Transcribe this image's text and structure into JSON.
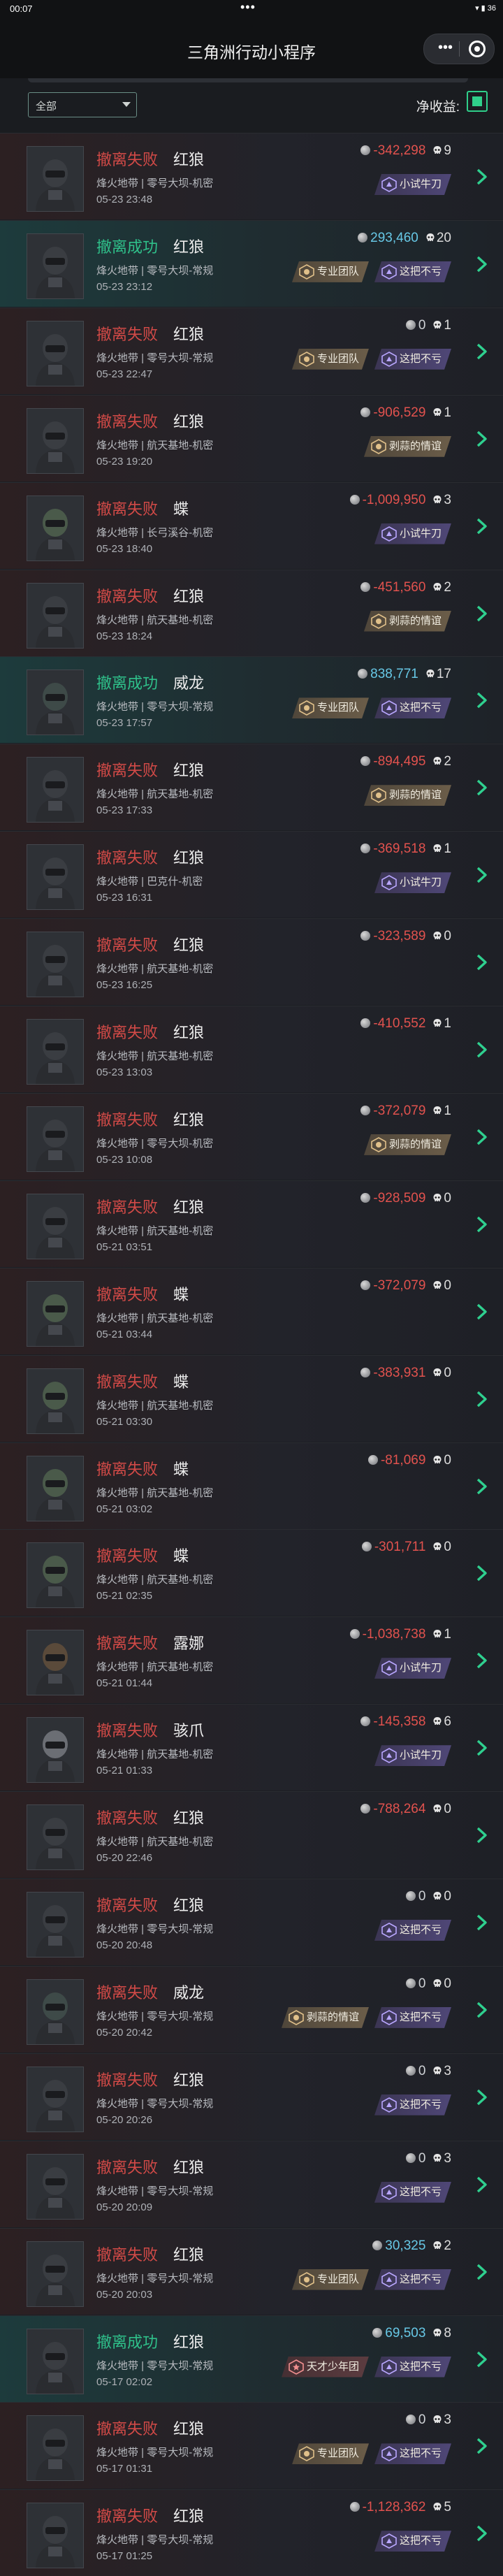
{
  "statusbar": {
    "time": "00:07",
    "dots": "•••",
    "sys": "▾ ▮ 36"
  },
  "app": {
    "title": "三角洲行动小程序"
  },
  "filter": {
    "selected": "全部"
  },
  "income_label": "净收益:",
  "colors": {
    "fail": "#d24a47",
    "success": "#2fc08a",
    "negative": "#e2524e",
    "positive": "#67c8e6",
    "toggle": "#2fcf8a"
  },
  "records": [
    {
      "result": "撤离失败",
      "operator": "红狼",
      "map": "烽火地带 | 零号大坝-机密",
      "date": "05-23 23:48",
      "amount": "-342,298",
      "kills": "9",
      "badges": [
        {
          "label": "小试牛刀",
          "style": "purple"
        }
      ]
    },
    {
      "result": "撤离成功",
      "operator": "红狼",
      "map": "烽火地带 | 零号大坝-常规",
      "date": "05-23 23:12",
      "amount": "293,460",
      "kills": "20",
      "badges": [
        {
          "label": "专业团队",
          "style": "gold"
        },
        {
          "label": "这把不亏",
          "style": "purple"
        }
      ]
    },
    {
      "result": "撤离失败",
      "operator": "红狼",
      "map": "烽火地带 | 零号大坝-常规",
      "date": "05-23 22:47",
      "amount": "0",
      "kills": "1",
      "badges": [
        {
          "label": "专业团队",
          "style": "gold"
        },
        {
          "label": "这把不亏",
          "style": "purple"
        }
      ]
    },
    {
      "result": "撤离失败",
      "operator": "红狼",
      "map": "烽火地带 | 航天基地-机密",
      "date": "05-23 19:20",
      "amount": "-906,529",
      "kills": "1",
      "badges": [
        {
          "label": "剥蒜的情谊",
          "style": "gold"
        }
      ]
    },
    {
      "result": "撤离失败",
      "operator": "蝶",
      "map": "烽火地带 | 长弓溪谷-机密",
      "date": "05-23 18:40",
      "amount": "-1,009,950",
      "kills": "3",
      "badges": [
        {
          "label": "小试牛刀",
          "style": "purple"
        }
      ]
    },
    {
      "result": "撤离失败",
      "operator": "红狼",
      "map": "烽火地带 | 航天基地-机密",
      "date": "05-23 18:24",
      "amount": "-451,560",
      "kills": "2",
      "badges": [
        {
          "label": "剥蒜的情谊",
          "style": "gold"
        }
      ]
    },
    {
      "result": "撤离成功",
      "operator": "威龙",
      "map": "烽火地带 | 零号大坝-常规",
      "date": "05-23 17:57",
      "amount": "838,771",
      "kills": "17",
      "badges": [
        {
          "label": "专业团队",
          "style": "gold"
        },
        {
          "label": "这把不亏",
          "style": "purple"
        }
      ]
    },
    {
      "result": "撤离失败",
      "operator": "红狼",
      "map": "烽火地带 | 航天基地-机密",
      "date": "05-23 17:33",
      "amount": "-894,495",
      "kills": "2",
      "badges": [
        {
          "label": "剥蒜的情谊",
          "style": "gold"
        }
      ]
    },
    {
      "result": "撤离失败",
      "operator": "红狼",
      "map": "烽火地带 | 巴克什-机密",
      "date": "05-23 16:31",
      "amount": "-369,518",
      "kills": "1",
      "badges": [
        {
          "label": "小试牛刀",
          "style": "purple"
        }
      ]
    },
    {
      "result": "撤离失败",
      "operator": "红狼",
      "map": "烽火地带 | 航天基地-机密",
      "date": "05-23 16:25",
      "amount": "-323,589",
      "kills": "0",
      "badges": []
    },
    {
      "result": "撤离失败",
      "operator": "红狼",
      "map": "烽火地带 | 航天基地-机密",
      "date": "05-23 13:03",
      "amount": "-410,552",
      "kills": "1",
      "badges": []
    },
    {
      "result": "撤离失败",
      "operator": "红狼",
      "map": "烽火地带 | 零号大坝-机密",
      "date": "05-23 10:08",
      "amount": "-372,079",
      "kills": "1",
      "badges": [
        {
          "label": "剥蒜的情谊",
          "style": "gold"
        }
      ]
    },
    {
      "result": "撤离失败",
      "operator": "红狼",
      "map": "烽火地带 | 航天基地-机密",
      "date": "05-21 03:51",
      "amount": "-928,509",
      "kills": "0",
      "badges": []
    },
    {
      "result": "撤离失败",
      "operator": "蝶",
      "map": "烽火地带 | 航天基地-机密",
      "date": "05-21 03:44",
      "amount": "-372,079",
      "kills": "0",
      "badges": []
    },
    {
      "result": "撤离失败",
      "operator": "蝶",
      "map": "烽火地带 | 航天基地-机密",
      "date": "05-21 03:30",
      "amount": "-383,931",
      "kills": "0",
      "badges": []
    },
    {
      "result": "撤离失败",
      "operator": "蝶",
      "map": "烽火地带 | 航天基地-机密",
      "date": "05-21 03:02",
      "amount": "-81,069",
      "kills": "0",
      "badges": []
    },
    {
      "result": "撤离失败",
      "operator": "蝶",
      "map": "烽火地带 | 航天基地-机密",
      "date": "05-21 02:35",
      "amount": "-301,711",
      "kills": "0",
      "badges": []
    },
    {
      "result": "撤离失败",
      "operator": "露娜",
      "map": "烽火地带 | 航天基地-机密",
      "date": "05-21 01:44",
      "amount": "-1,038,738",
      "kills": "1",
      "badges": [
        {
          "label": "小试牛刀",
          "style": "purple"
        }
      ]
    },
    {
      "result": "撤离失败",
      "operator": "骇爪",
      "map": "烽火地带 | 航天基地-机密",
      "date": "05-21 01:33",
      "amount": "-145,358",
      "kills": "6",
      "badges": [
        {
          "label": "小试牛刀",
          "style": "purple"
        }
      ]
    },
    {
      "result": "撤离失败",
      "operator": "红狼",
      "map": "烽火地带 | 航天基地-机密",
      "date": "05-20 22:46",
      "amount": "-788,264",
      "kills": "0",
      "badges": []
    },
    {
      "result": "撤离失败",
      "operator": "红狼",
      "map": "烽火地带 | 零号大坝-常规",
      "date": "05-20 20:48",
      "amount": "0",
      "kills": "0",
      "badges": [
        {
          "label": "这把不亏",
          "style": "purple"
        }
      ]
    },
    {
      "result": "撤离失败",
      "operator": "威龙",
      "map": "烽火地带 | 零号大坝-常规",
      "date": "05-20 20:42",
      "amount": "0",
      "kills": "0",
      "badges": [
        {
          "label": "剥蒜的情谊",
          "style": "gold"
        },
        {
          "label": "这把不亏",
          "style": "purple"
        }
      ]
    },
    {
      "result": "撤离失败",
      "operator": "红狼",
      "map": "烽火地带 | 零号大坝-常规",
      "date": "05-20 20:26",
      "amount": "0",
      "kills": "3",
      "badges": [
        {
          "label": "这把不亏",
          "style": "purple"
        }
      ]
    },
    {
      "result": "撤离失败",
      "operator": "红狼",
      "map": "烽火地带 | 零号大坝-常规",
      "date": "05-20 20:09",
      "amount": "0",
      "kills": "3",
      "badges": [
        {
          "label": "这把不亏",
          "style": "purple"
        }
      ]
    },
    {
      "result": "撤离失败",
      "operator": "红狼",
      "map": "烽火地带 | 零号大坝-常规",
      "date": "05-20 20:03",
      "amount": "30,325",
      "kills": "2",
      "badges": [
        {
          "label": "专业团队",
          "style": "gold"
        },
        {
          "label": "这把不亏",
          "style": "purple"
        }
      ]
    },
    {
      "result": "撤离成功",
      "operator": "红狼",
      "map": "烽火地带 | 零号大坝-常规",
      "date": "05-17 02:02",
      "amount": "69,503",
      "kills": "8",
      "badges": [
        {
          "label": "天才少年团",
          "style": "red"
        },
        {
          "label": "这把不亏",
          "style": "purple"
        }
      ]
    },
    {
      "result": "撤离失败",
      "operator": "红狼",
      "map": "烽火地带 | 零号大坝-常规",
      "date": "05-17 01:31",
      "amount": "0",
      "kills": "3",
      "badges": [
        {
          "label": "专业团队",
          "style": "gold"
        },
        {
          "label": "这把不亏",
          "style": "purple"
        }
      ]
    },
    {
      "result": "撤离失败",
      "operator": "红狼",
      "map": "烽火地带 | 零号大坝-常规",
      "date": "05-17 01:25",
      "amount": "-1,128,362",
      "kills": "5",
      "badges": [
        {
          "label": "这把不亏",
          "style": "purple"
        }
      ]
    }
  ]
}
